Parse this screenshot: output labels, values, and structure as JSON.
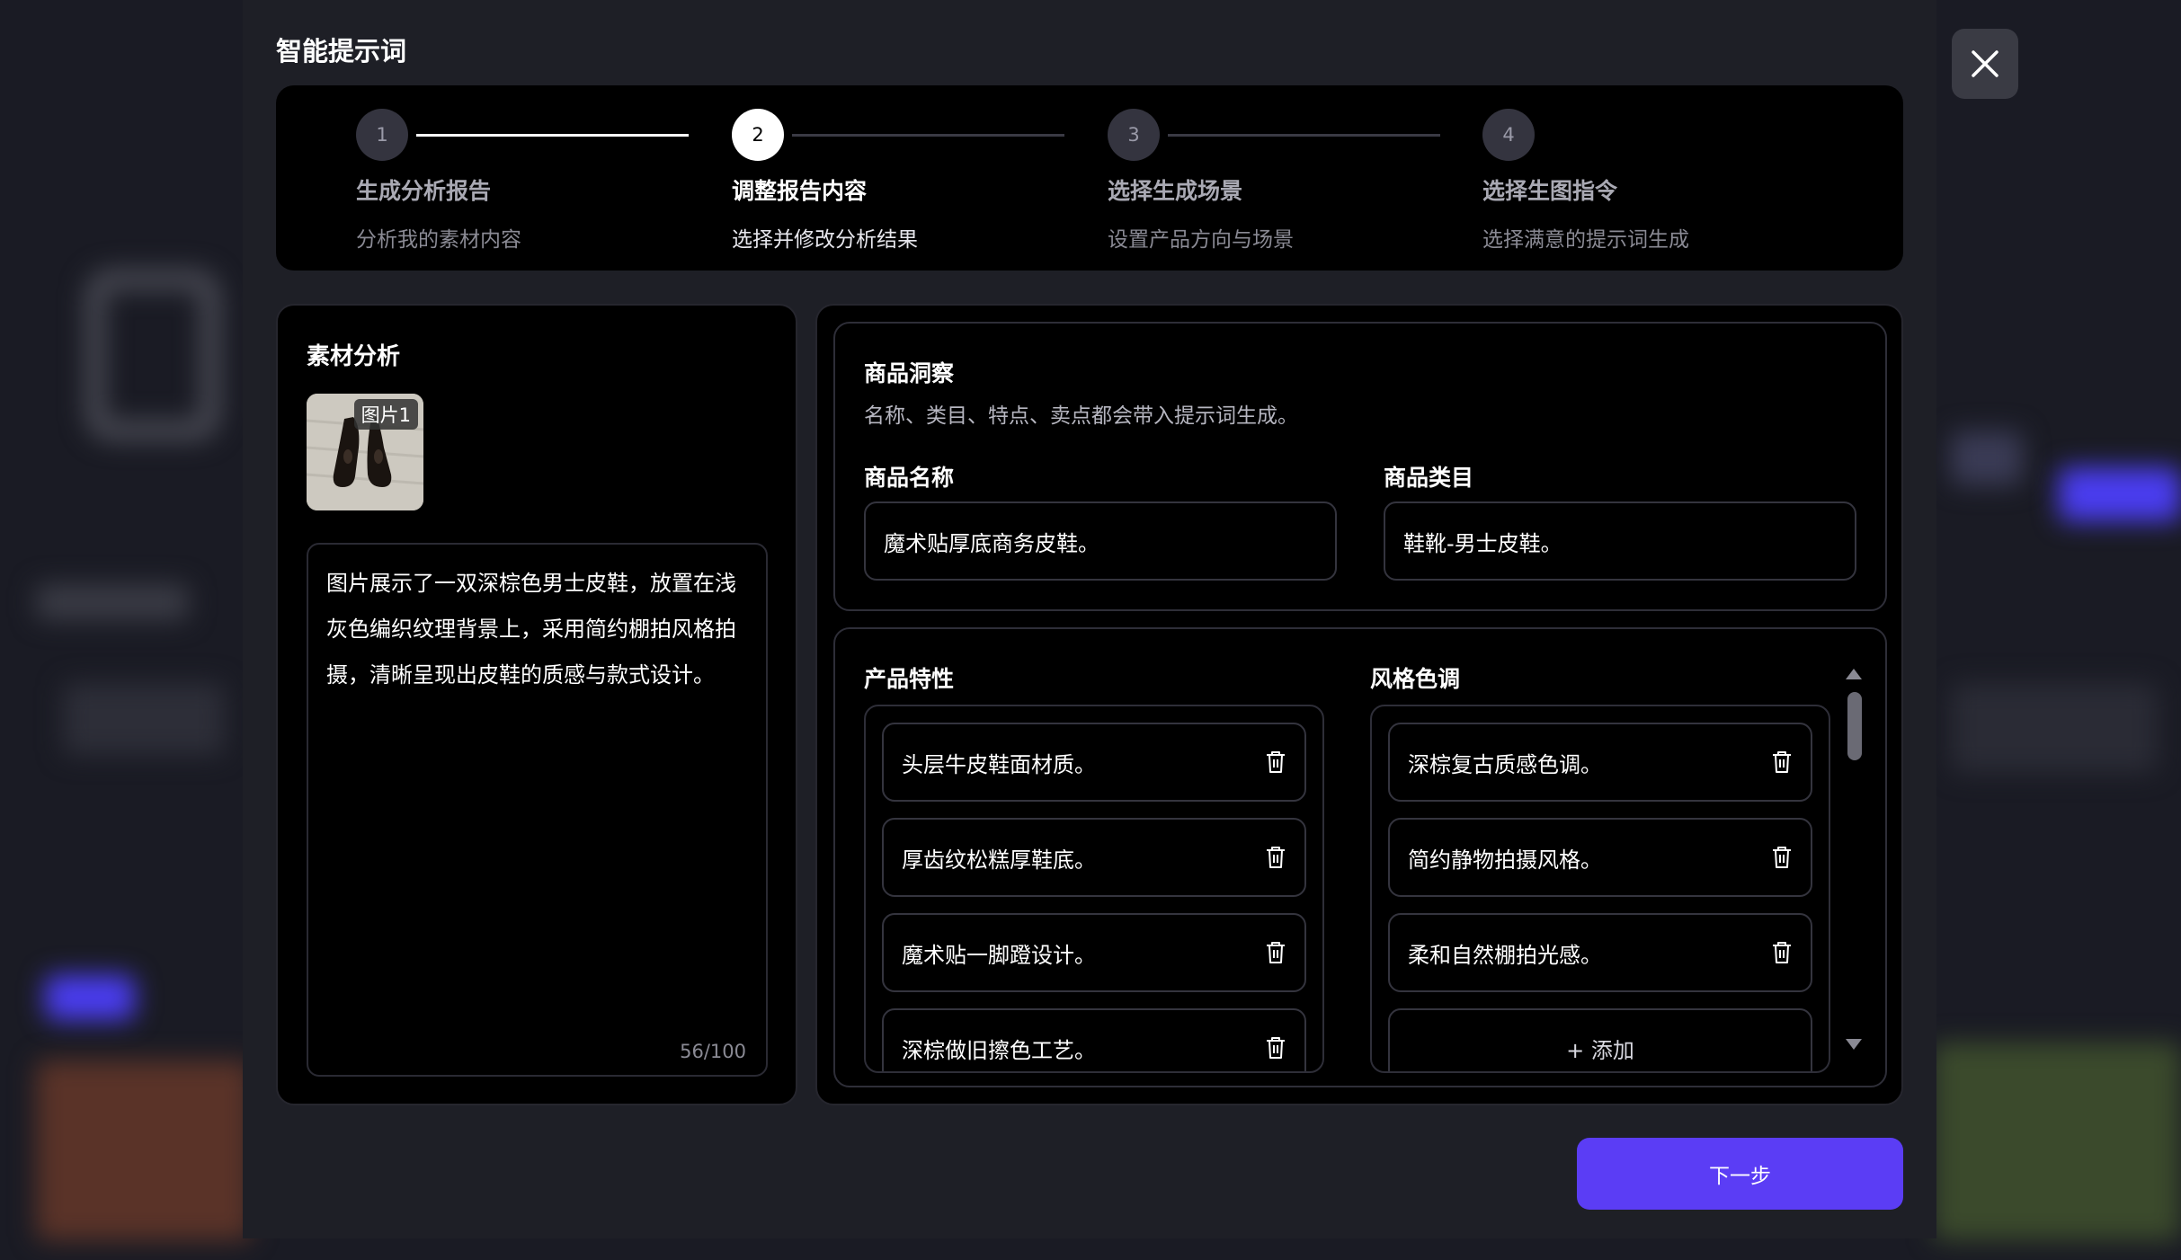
{
  "modal": {
    "title": "智能提示词"
  },
  "steps": [
    {
      "number": "1",
      "title": "生成分析报告",
      "subtitle": "分析我的素材内容"
    },
    {
      "number": "2",
      "title": "调整报告内容",
      "subtitle": "选择并修改分析结果"
    },
    {
      "number": "3",
      "title": "选择生成场景",
      "subtitle": "设置产品方向与场景"
    },
    {
      "number": "4",
      "title": "选择生图指令",
      "subtitle": "选择满意的提示词生成"
    }
  ],
  "material": {
    "title": "素材分析",
    "image_label": "图片1",
    "description": "图片展示了一双深棕色男士皮鞋，放置在浅灰色编织纹理背景上，采用简约棚拍风格拍摄，清晰呈现出皮鞋的质感与款式设计。",
    "char_count": "56/100"
  },
  "insight": {
    "title": "商品洞察",
    "subtitle": "名称、类目、特点、卖点都会带入提示词生成。",
    "name_label": "商品名称",
    "name_value": "魔术贴厚底商务皮鞋。",
    "category_label": "商品类目",
    "category_value": "鞋靴-男士皮鞋。"
  },
  "features": {
    "title": "产品特性",
    "items": [
      "头层牛皮鞋面材质。",
      "厚齿纹松糕厚鞋底。",
      "魔术贴一脚蹬设计。",
      "深棕做旧擦色工艺。"
    ]
  },
  "style": {
    "title": "风格色调",
    "items": [
      "深棕复古质感色调。",
      "简约静物拍摄风格。",
      "柔和自然棚拍光感。"
    ],
    "add_label": "+ 添加"
  },
  "footer": {
    "next_label": "下一步"
  },
  "colors": {
    "accent": "#5b3df5",
    "panel": "#000000",
    "modal": "#1e1f26"
  }
}
